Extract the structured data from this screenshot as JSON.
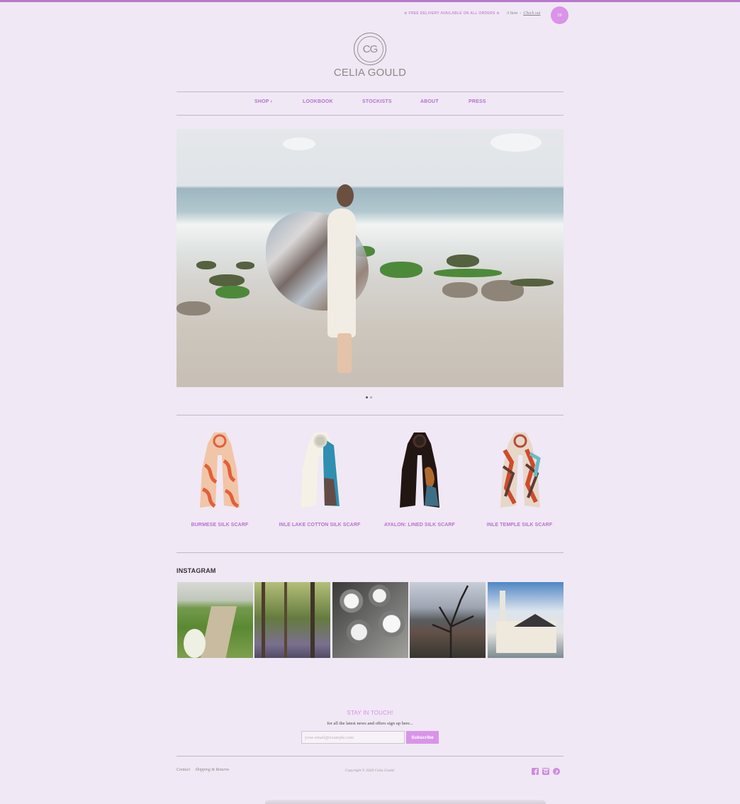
{
  "header": {
    "promo": "★ FREE DELIVERY AVAILABLE ON ALL ORDERS ★",
    "cart_count": "0 Item",
    "checkout": "Check out",
    "cart_total": "£0"
  },
  "brand": {
    "monogram": "CG",
    "name": "CELIA GOULD"
  },
  "nav": [
    {
      "label": "SHOP ›"
    },
    {
      "label": "LOOKBOOK"
    },
    {
      "label": "STOCKISTS"
    },
    {
      "label": "ABOUT"
    },
    {
      "label": "PRESS"
    }
  ],
  "hero": {
    "slides": 2,
    "active_slide": 1
  },
  "products": [
    {
      "name": "BURMESE SILK SCARF",
      "colors": [
        "#f0c6a8",
        "#e8643a"
      ]
    },
    {
      "name": "INLE LAKE COTTON SILK SCARF",
      "colors": [
        "#f6f2e8",
        "#2f95b6"
      ]
    },
    {
      "name": "AYALON: LINED SILK SCARF",
      "colors": [
        "#2a1a17",
        "#a8682f"
      ]
    },
    {
      "name": "INLE TEMPLE SILK SCARF",
      "colors": [
        "#e5d6c9",
        "#cf4d2f"
      ]
    }
  ],
  "instagram": {
    "title": "INSTAGRAM"
  },
  "newsletter": {
    "title": "STAY IN TOUCH!",
    "subtitle": "for all the latest news and offers sign up here...",
    "email_placeholder": "your-email@example.com",
    "button_label": "Subscribe"
  },
  "footer": {
    "links": [
      "Contact",
      "Shipping & Returns"
    ],
    "copyright": "Copyright © 2020 Celia Gould.",
    "social_icons": [
      "facebook-icon",
      "instagram-icon",
      "pinterest-icon"
    ],
    "accent": "#b86fd0"
  }
}
